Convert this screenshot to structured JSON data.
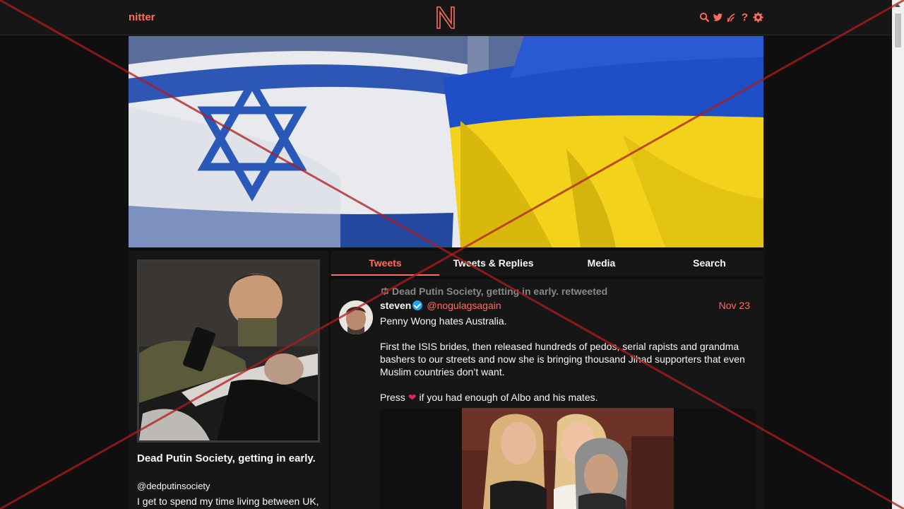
{
  "nav": {
    "logo": "nitter",
    "icons": [
      "search-icon",
      "twitter-icon",
      "rss-icon",
      "help-icon",
      "settings-icon"
    ],
    "help_glyph": "?"
  },
  "banner": {
    "description_icon": "israel-ukraine-flags-image"
  },
  "profile": {
    "name": "Dead Putin Society, getting in early.",
    "handle": "@dedputinsociety",
    "bio": "I get to spend my time living between UK,"
  },
  "tabs": [
    {
      "label": "Tweets",
      "active": true
    },
    {
      "label": "Tweets & Replies",
      "active": false
    },
    {
      "label": "Media",
      "active": false
    },
    {
      "label": "Search",
      "active": false
    }
  ],
  "tweet": {
    "retweet_text": "Dead Putin Society, getting in early. retweeted",
    "fullname": "steven",
    "username": "@nogulagsagain",
    "date": "Nov 23",
    "paragraph1": "Penny Wong hates Australia.",
    "paragraph2": "First the ISIS brides, then released hundreds of pedos, serial rapists and grandma bashers to our streets and now she is bringing thousand Jihad supporters that even Muslim countries don’t want.",
    "paragraph3_before": "Press",
    "paragraph3_after": "if you had enough of Albo and his mates."
  },
  "colors": {
    "accent": "#ff6c60",
    "background": "#0f0f0f",
    "panel": "#161616",
    "overlay_x": "#b01c1c"
  }
}
